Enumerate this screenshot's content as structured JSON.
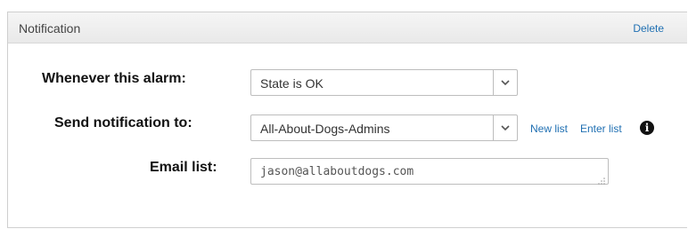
{
  "panel": {
    "title": "Notification",
    "delete_label": "Delete"
  },
  "alarm_row": {
    "label": "Whenever this alarm:",
    "selected_value": "State is OK"
  },
  "notify_row": {
    "label": "Send notification to:",
    "selected_value": "All-About-Dogs-Admins",
    "new_list_label": "New list",
    "enter_list_label": "Enter list",
    "info_icon": "info-icon"
  },
  "email_row": {
    "label": "Email list:",
    "value": "jason@allaboutdogs.com"
  },
  "colors": {
    "link": "#1f6fb2",
    "header_bg": "#eeeeee",
    "border": "#bdbdbd"
  }
}
